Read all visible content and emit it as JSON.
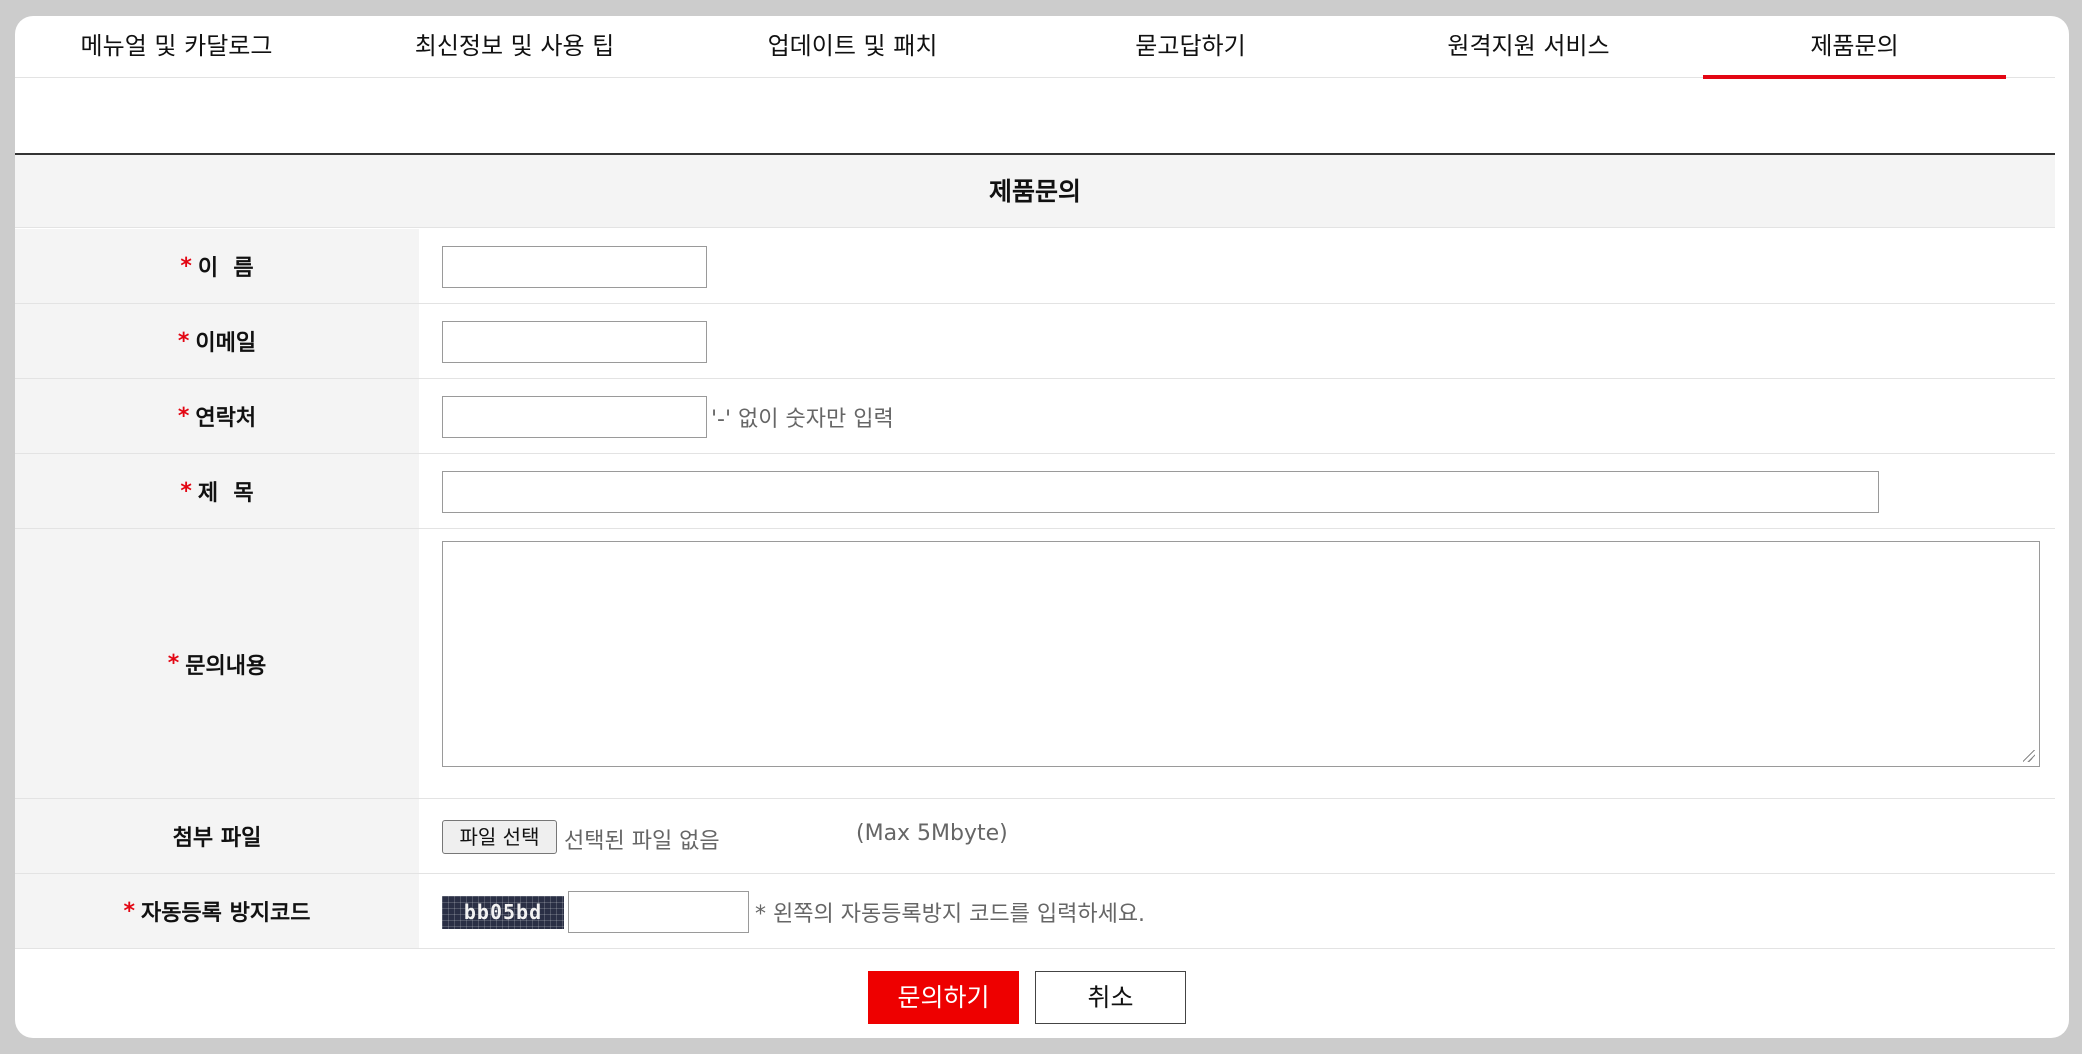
{
  "tabs": [
    {
      "label": "메뉴얼 및 카달로그",
      "active": false
    },
    {
      "label": "최신정보 및 사용 팁",
      "active": false
    },
    {
      "label": "업데이트 및 패치",
      "active": false
    },
    {
      "label": "묻고답하기",
      "active": false
    },
    {
      "label": "원격지원 서비스",
      "active": false
    },
    {
      "label": "제품문의",
      "active": true
    }
  ],
  "form": {
    "title": "제품문의",
    "required_mark": "*",
    "fields": {
      "name": {
        "label": "이  름",
        "value": ""
      },
      "email": {
        "label": "이메일",
        "value": ""
      },
      "phone": {
        "label": "연락처",
        "value": "",
        "hint": "'-' 없이 숫자만 입력"
      },
      "subject": {
        "label": "제  목",
        "value": ""
      },
      "content": {
        "label": "문의내용",
        "value": ""
      },
      "attachment": {
        "label": "첨부 파일",
        "button": "파일 선택",
        "status": "선택된 파일 없음",
        "limit": "(Max 5Mbyte)"
      },
      "captcha": {
        "label": "자동등록 방지코드",
        "code": "bb05bd",
        "value": "",
        "hint": "* 왼쪽의 자동등록방지 코드를 입력하세요."
      }
    }
  },
  "buttons": {
    "submit": "문의하기",
    "cancel": "취소"
  },
  "colors": {
    "accent": "#e30613",
    "submit_bg": "#ee0000",
    "label_bg": "#f4f4f4"
  }
}
